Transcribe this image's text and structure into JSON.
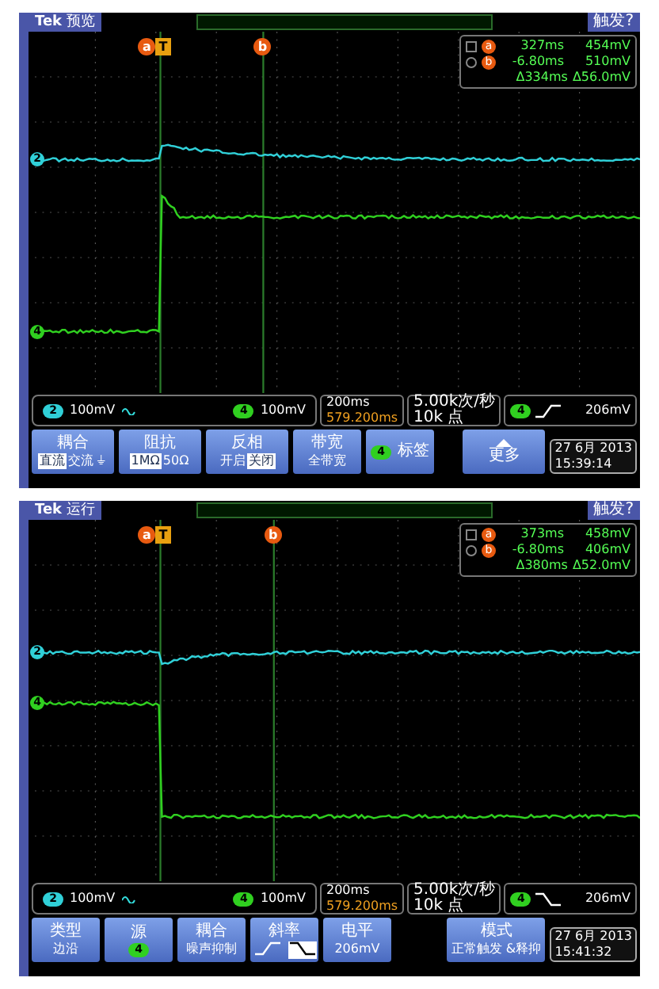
{
  "scopes": [
    {
      "header": {
        "brand": "Tek",
        "mode": "预览",
        "trigger_status": "触发?"
      },
      "cursors": [
        {
          "label": "a"
        },
        {
          "label": "b"
        }
      ],
      "trigger_marker": "T",
      "traces": [
        {
          "channel": "2",
          "color": "#30d0d8",
          "kind": "rise-decay"
        },
        {
          "channel": "4",
          "color": "#30d020",
          "kind": "step-high"
        }
      ],
      "readout": [
        {
          "cursor": "a",
          "time": "327ms",
          "voltage": "454mV"
        },
        {
          "cursor": "b",
          "time": "-6.80ms",
          "voltage": "510mV"
        },
        {
          "time": "Δ334ms",
          "voltage": "Δ56.0mV"
        }
      ],
      "channel_bar": [
        {
          "channel": "2",
          "color": "#30d0d8",
          "scale": "100mV",
          "bandwidth_limit": true
        },
        {
          "channel": "4",
          "color": "#30d020",
          "scale": "100mV"
        }
      ],
      "timebase": {
        "scale": "200ms",
        "position": "579.200ms"
      },
      "sampling": {
        "rate": "5.00k次/秒",
        "points": "10k 点"
      },
      "trigger": {
        "channel": "4",
        "color": "#30d020",
        "kind": "rising",
        "level": "206mV"
      },
      "menu": [
        {
          "kind": "options",
          "title": "耦合",
          "options": [
            {
              "label": "直流",
              "selected": true
            },
            {
              "label": "交流",
              "selected": false
            },
            {
              "label": "⏚",
              "selected": false
            }
          ]
        },
        {
          "kind": "options",
          "title": "阻抗",
          "options": [
            {
              "label": "1MΩ",
              "selected": true
            },
            {
              "label": "50Ω",
              "selected": false
            }
          ]
        },
        {
          "kind": "options",
          "title": "反相",
          "options": [
            {
              "label": "开启",
              "selected": false
            },
            {
              "label": "关闭",
              "selected": true
            }
          ]
        },
        {
          "kind": "value",
          "title": "带宽",
          "value": "全带宽"
        },
        {
          "kind": "badge",
          "channel": "4",
          "color": "#30d020",
          "title": "标签"
        },
        {
          "kind": "gap"
        },
        {
          "kind": "more",
          "title": "更多"
        }
      ],
      "date": "27 6月 2013",
      "time": "15:39:14"
    },
    {
      "header": {
        "brand": "Tek",
        "mode": "运行",
        "trigger_status": "触发?"
      },
      "cursors": [
        {
          "label": "a"
        },
        {
          "label": "b"
        }
      ],
      "trigger_marker": "T",
      "traces": [
        {
          "channel": "2",
          "color": "#30d0d8",
          "kind": "dip-recover"
        },
        {
          "channel": "4",
          "color": "#30d020",
          "kind": "step-low"
        }
      ],
      "readout": [
        {
          "cursor": "a",
          "time": "373ms",
          "voltage": "458mV"
        },
        {
          "cursor": "b",
          "time": "-6.80ms",
          "voltage": "406mV"
        },
        {
          "time": "Δ380ms",
          "voltage": "Δ52.0mV"
        }
      ],
      "channel_bar": [
        {
          "channel": "2",
          "color": "#30d0d8",
          "scale": "100mV",
          "bandwidth_limit": true
        },
        {
          "channel": "4",
          "color": "#30d020",
          "scale": "100mV"
        }
      ],
      "timebase": {
        "scale": "200ms",
        "position": "579.200ms"
      },
      "sampling": {
        "rate": "5.00k次/秒",
        "points": "10k 点"
      },
      "trigger": {
        "channel": "4",
        "color": "#30d020",
        "kind": "falling",
        "level": "206mV"
      },
      "menu": [
        {
          "kind": "value",
          "title": "类型",
          "value": "边沿"
        },
        {
          "kind": "source",
          "title": "源",
          "channel": "4",
          "color": "#30d020"
        },
        {
          "kind": "value",
          "title": "耦合",
          "value": "噪声抑制"
        },
        {
          "kind": "slope",
          "title": "斜率",
          "options": [
            {
              "kind": "rising",
              "selected": false
            },
            {
              "kind": "falling",
              "selected": true
            }
          ]
        },
        {
          "kind": "value",
          "title": "电平",
          "value": "206mV"
        },
        {
          "kind": "gap"
        },
        {
          "kind": "value",
          "title": "模式",
          "value": "正常触发 &释抑"
        }
      ],
      "date": "27 6月 2013",
      "time": "15:41:32"
    }
  ]
}
